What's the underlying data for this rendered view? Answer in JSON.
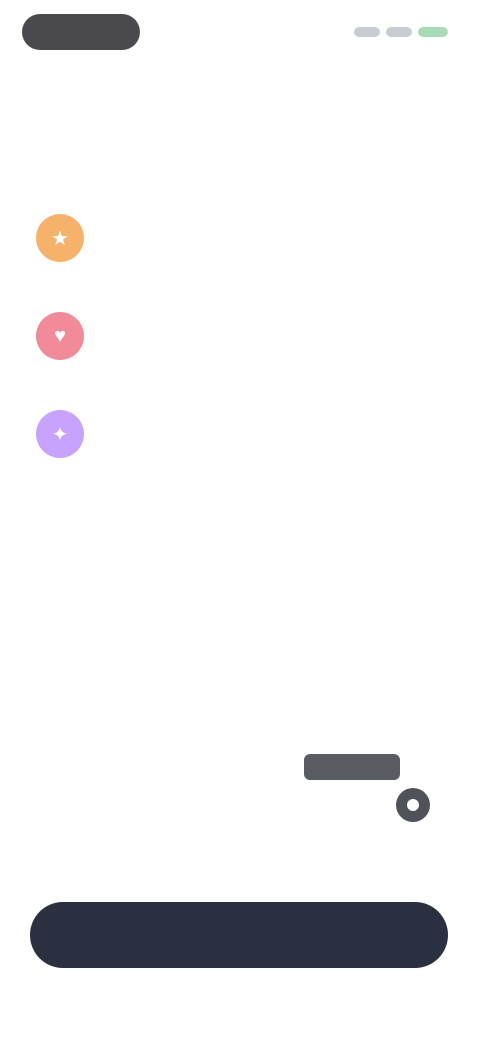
{
  "topbar": {
    "left_pill_label": "",
    "center_label": "",
    "right_segments": [
      "gray",
      "gray",
      "green"
    ]
  },
  "heading": "",
  "features": [
    {
      "icon": "star-icon",
      "color": "#f6b26b",
      "title": "",
      "desc": ""
    },
    {
      "icon": "heart-icon",
      "color": "#f28b99",
      "title": "",
      "desc": ""
    },
    {
      "icon": "sparkle-icon",
      "color": "#c8a2ff",
      "title": "",
      "desc": ""
    }
  ],
  "plan": {
    "badge": "",
    "left_label_top": "",
    "left_label_main": "",
    "right_label": ""
  },
  "note": "",
  "cta_label": "",
  "colors": {
    "accent_dark": "#2a3040",
    "badge": "#5a5c63"
  }
}
